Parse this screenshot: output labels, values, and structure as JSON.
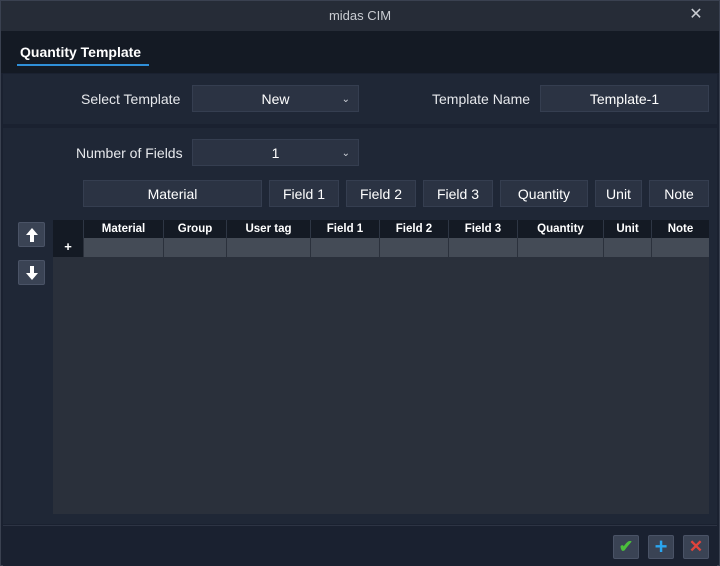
{
  "window": {
    "title": "midas CIM",
    "close_glyph": "✕"
  },
  "tab": {
    "label": "Quantity Template"
  },
  "template": {
    "select_label": "Select Template",
    "select_value": "New",
    "name_label": "Template Name",
    "name_value": "Template-1"
  },
  "fields": {
    "count_label": "Number of Fields",
    "count_value": "1",
    "buttons": [
      "Material",
      "Field 1",
      "Field 2",
      "Field 3",
      "Quantity",
      "Unit",
      "Note"
    ]
  },
  "grid": {
    "columns": [
      "Material",
      "Group",
      "User tag",
      "Field 1",
      "Field 2",
      "Field 3",
      "Quantity",
      "Unit",
      "Note"
    ],
    "new_row_marker": "+"
  },
  "footer": {
    "ok_glyph": "✔",
    "add_glyph": "+",
    "cancel_glyph": "✕"
  },
  "colors": {
    "accent": "#2f8fd8",
    "ok": "#4bbf3c",
    "add": "#2aa6f0",
    "cancel": "#e0443c"
  }
}
